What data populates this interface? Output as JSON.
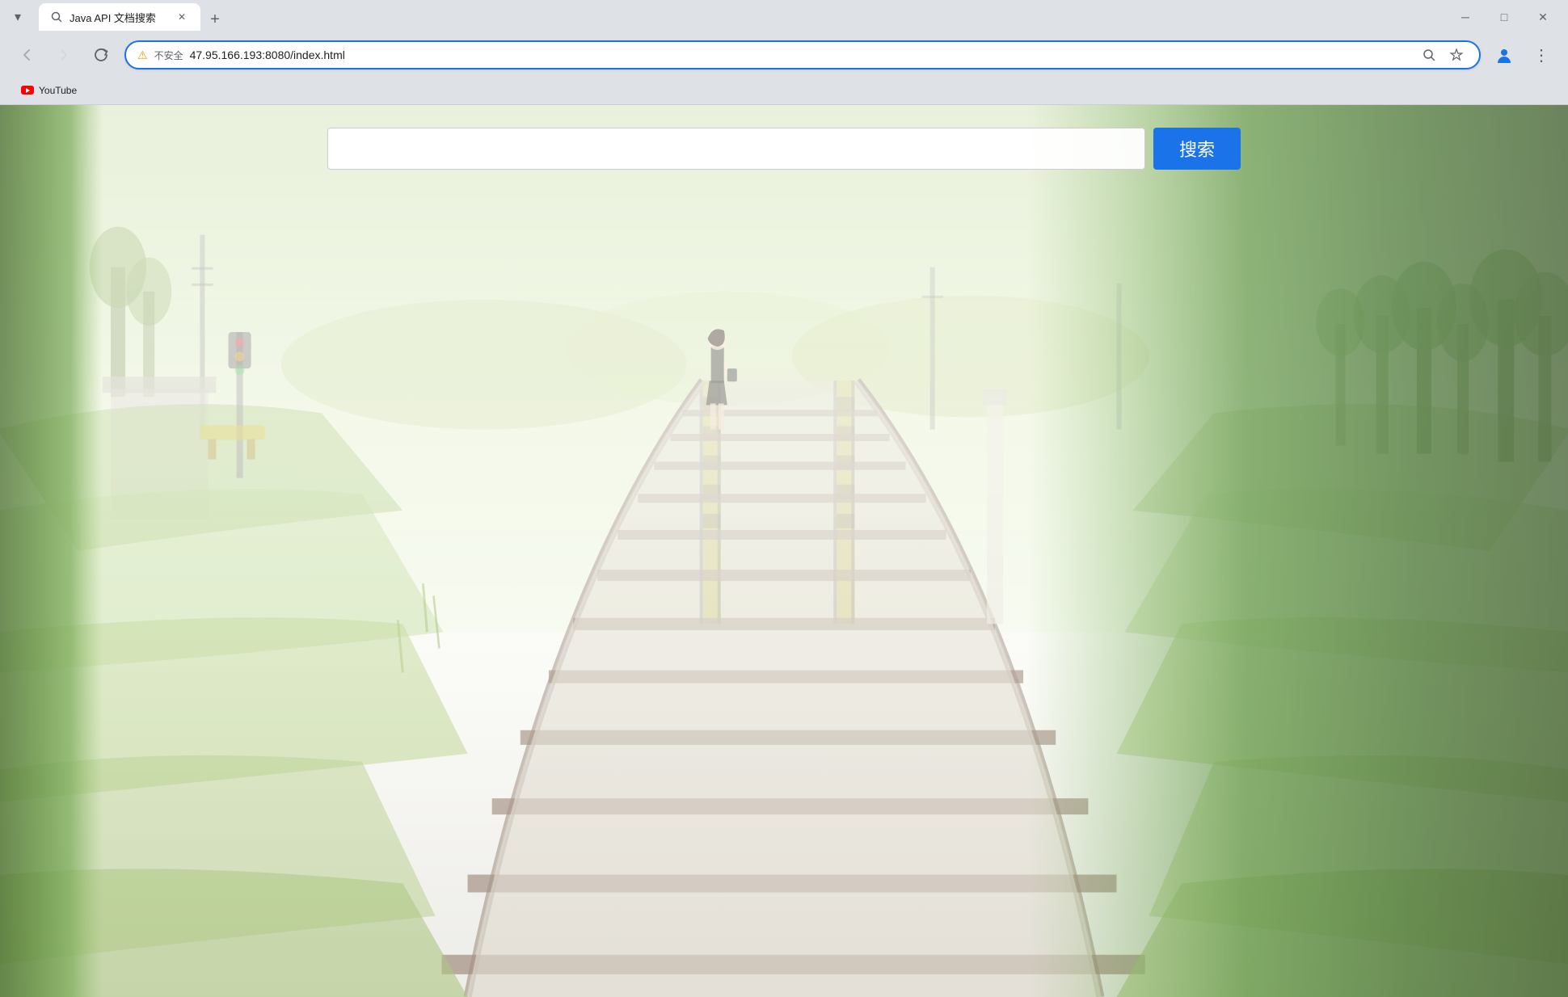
{
  "browser": {
    "title": "Java API 文档搜索",
    "tab_title": "Java API 文档搜索",
    "url": "47.95.166.193:8080/index.html",
    "security_label": "不安全",
    "new_tab_label": "+",
    "back_disabled": false,
    "forward_disabled": true
  },
  "nav": {
    "back_icon": "←",
    "forward_icon": "→",
    "refresh_icon": "↻",
    "search_icon": "🔍",
    "star_icon": "☆",
    "profile_icon": "👤",
    "menu_icon": "⋮"
  },
  "window_controls": {
    "minimize": "─",
    "maximize": "□",
    "close": "✕"
  },
  "bookmarks": [
    {
      "label": "YouTube",
      "has_yt_icon": true
    }
  ],
  "page": {
    "search_placeholder": "",
    "search_button_label": "搜索"
  }
}
